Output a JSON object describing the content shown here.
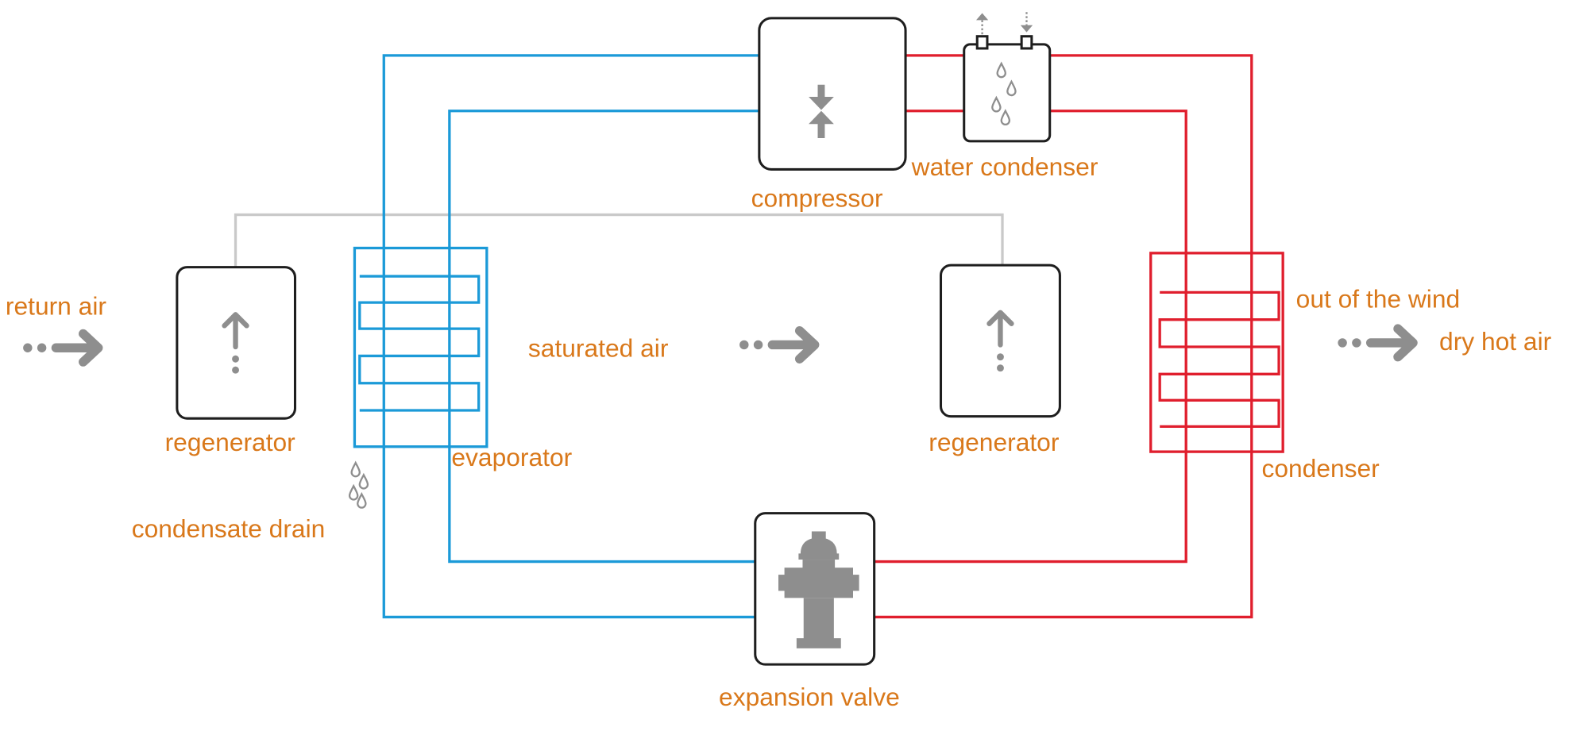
{
  "colors": {
    "cold_loop": "#1b9ad8",
    "hot_loop": "#e01e2d",
    "air_duct": "#c9c9c9",
    "label_text": "#d9781a",
    "icon_gray": "#8e8e8e",
    "component_outline": "#1e1e1e"
  },
  "labels": {
    "return_air": "return air",
    "regenerator_left": "regenerator",
    "evaporator": "evaporator",
    "condensate_drain": "condensate drain",
    "saturated_air": "saturated air",
    "regenerator_right": "regenerator",
    "compressor": "compressor",
    "water_condenser": "water condenser",
    "out_of_the_wind": "out of the wind",
    "dry_hot_air": "dry hot air",
    "condenser": "condenser",
    "expansion_valve": "expansion valve"
  },
  "icons": {
    "compressor": "compress-arrows-icon",
    "water_condenser": "water-drops-icon",
    "regenerator": "up-arrow-dotted-icon",
    "expansion_valve": "hydrant-valve-icon",
    "air_flow": "dotted-right-arrow-icon",
    "condensate": "water-drops-icon"
  }
}
